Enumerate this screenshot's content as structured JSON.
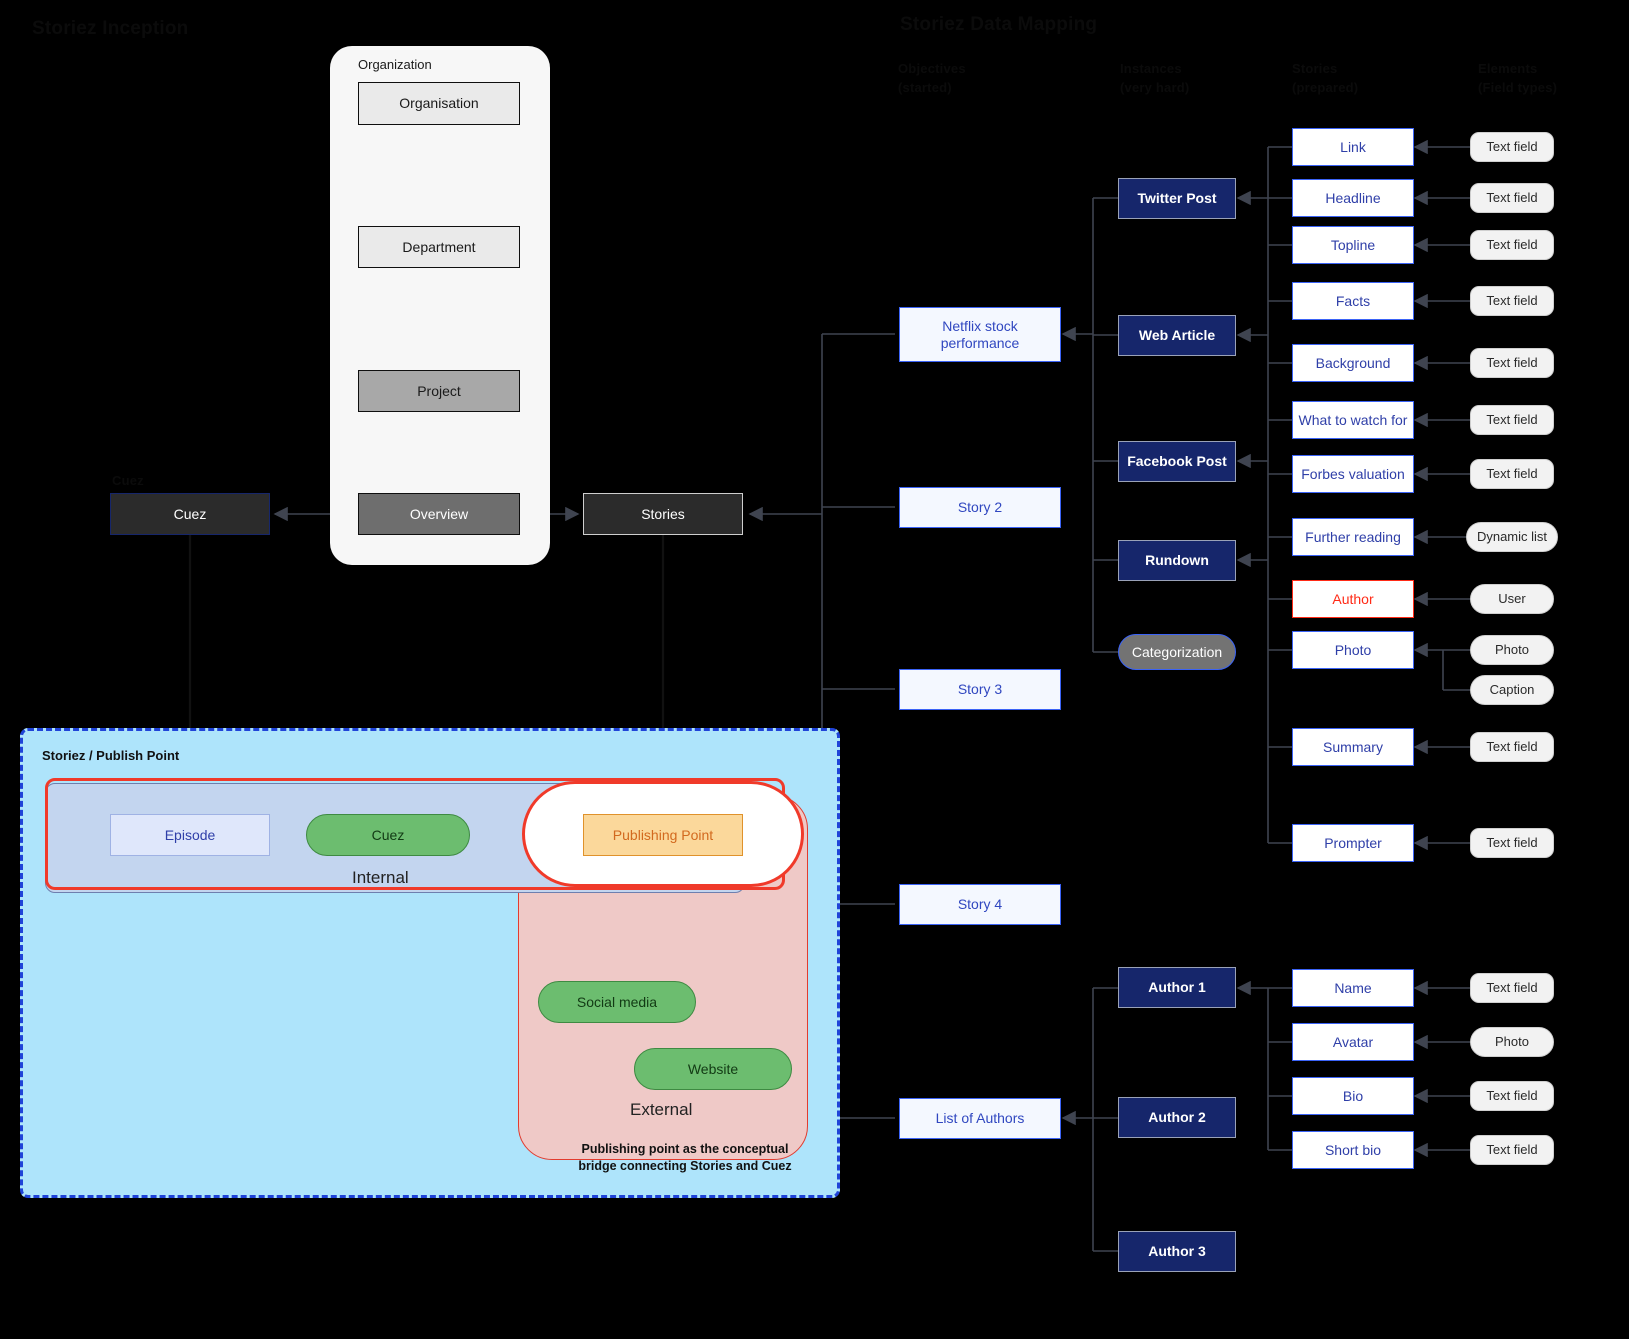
{
  "headings": {
    "left_title": "Storiez Inception",
    "right_title": "Storiez Data Mapping",
    "columns": [
      "Objectives\n(started)",
      "Instances\n(very hard)",
      "Stories\n(prepared)",
      "Elements\n(Field types)"
    ],
    "col1": "Objectives",
    "col1b": "(started)",
    "col2": "Instances",
    "col2b": "(very hard)",
    "col3": "Stories",
    "col3b": "(prepared)",
    "col4": "Elements",
    "col4b": "(Field types)",
    "cuez_group_label": "Cuez"
  },
  "organization": {
    "panel_title": "Organization",
    "levels": [
      "Organisation",
      "Department",
      "Project",
      "Overview"
    ]
  },
  "spine": {
    "cuez": "Cuez",
    "stories": "Stories"
  },
  "stories": [
    {
      "label": "Netflix stock\nperformance",
      "line1": "Netflix stock",
      "line2": "performance"
    },
    {
      "label": "Story 2"
    },
    {
      "label": "Story 3"
    },
    {
      "label": "Story 4"
    },
    {
      "label": "List of Authors"
    }
  ],
  "instances": [
    {
      "label": "Twitter Post"
    },
    {
      "label": "Web Article"
    },
    {
      "label": "Facebook Post"
    },
    {
      "label": "Rundown"
    },
    {
      "label": "Categorization",
      "shape": "pill"
    }
  ],
  "authors": [
    {
      "label": "Author 1"
    },
    {
      "label": "Author 2"
    },
    {
      "label": "Author 3"
    }
  ],
  "story_fields": [
    {
      "name": "Link",
      "type": "Text field"
    },
    {
      "name": "Headline",
      "type": "Text field"
    },
    {
      "name": "Topline",
      "type": "Text field"
    },
    {
      "name": "Facts",
      "type": "Text field"
    },
    {
      "name": "Background",
      "type": "Text field"
    },
    {
      "name": "What to watch for",
      "type": "Text field"
    },
    {
      "name": "Forbes valuation",
      "type": "Text field"
    },
    {
      "name": "Further reading",
      "type": "Dynamic list"
    },
    {
      "name": "Author",
      "type": "User",
      "alert": true
    },
    {
      "name": "Photo",
      "type": "Photo",
      "type2": "Caption"
    },
    {
      "name": "Summary",
      "type": "Text field"
    },
    {
      "name": "Prompter",
      "type": "Text field"
    }
  ],
  "author_fields": [
    {
      "name": "Name",
      "type": "Text field"
    },
    {
      "name": "Avatar",
      "type": "Photo"
    },
    {
      "name": "Bio",
      "type": "Text field"
    },
    {
      "name": "Short bio",
      "type": "Text field"
    }
  ],
  "publish_point": {
    "title": "Storiez / Publish Point",
    "internal_label": "Internal",
    "external_label": "External",
    "episode": "Episode",
    "cuez": "Cuez",
    "publishing_point": "Publishing Point",
    "social_media": "Social media",
    "website": "Website",
    "caption_line1": "Publishing point as the conceptual",
    "caption_line2": "bridge connecting Stories and Cuez"
  },
  "colors": {
    "navy": "#16266b",
    "blue_border": "#3b63f6",
    "alert_red": "#ff2a16",
    "green": "#6cbd6f",
    "orange": "#fbd89b",
    "pp_blue": "#aee4fb",
    "external_pink": "#efc9c7",
    "internal_blue": "#c3d5ef"
  }
}
